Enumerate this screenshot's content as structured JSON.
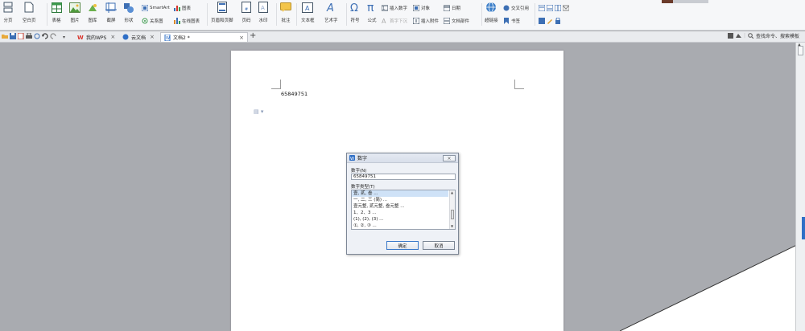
{
  "ribbon": {
    "page_break": "分页",
    "blank_page": "空白页",
    "table": "表格",
    "picture": "图片",
    "gallery": "图库",
    "screenshot": "截屏",
    "shape": "形状",
    "smartart": "SmartArt",
    "chart": "图表",
    "relation_chart": "关系图",
    "online_chart": "在线图表",
    "header_footer": "页眉和页脚",
    "page_number": "页码",
    "watermark": "水印",
    "comment": "批注",
    "textbox": "文本框",
    "wordart": "艺术字",
    "symbol": "符号",
    "formula": "公式",
    "insert_number": "插入数字",
    "object": "对象",
    "date": "日期",
    "first_letter_sink": "首字下沉",
    "insert_attachment": "插入附件",
    "doc_parts": "文档部件",
    "hyperlink": "超链接",
    "cross_ref": "交叉引用",
    "bookmark": "书签"
  },
  "tabs": [
    {
      "label": "我的WPS",
      "active": false
    },
    {
      "label": "云文档",
      "active": false
    },
    {
      "label": "文档2 *",
      "active": true
    }
  ],
  "toolbar_right": {
    "search_placeholder": "查找命令、搜索模板"
  },
  "document": {
    "text": "65849751"
  },
  "dialog": {
    "title": "数字",
    "number_label": "数字(N)",
    "number_value": "65849751",
    "type_label": "数字类型(T)",
    "types": [
      {
        "label": "壹, 贰, 叁 ...",
        "selected": true
      },
      {
        "label": "一, 二, 三 (简) ...",
        "selected": false
      },
      {
        "label": "壹元整, 贰元整, 叁元整 ...",
        "selected": false
      },
      {
        "label": "1、2、3 ...",
        "selected": false
      },
      {
        "label": "(1), (2), (3) ...",
        "selected": false
      },
      {
        "label": "①, ②, ③ ...",
        "selected": false
      }
    ],
    "ok": "确定",
    "cancel": "取消"
  },
  "colors": {
    "accent": "#2f6fc6",
    "workspace": "#a9abb0",
    "wps_red": "#d9342b"
  }
}
